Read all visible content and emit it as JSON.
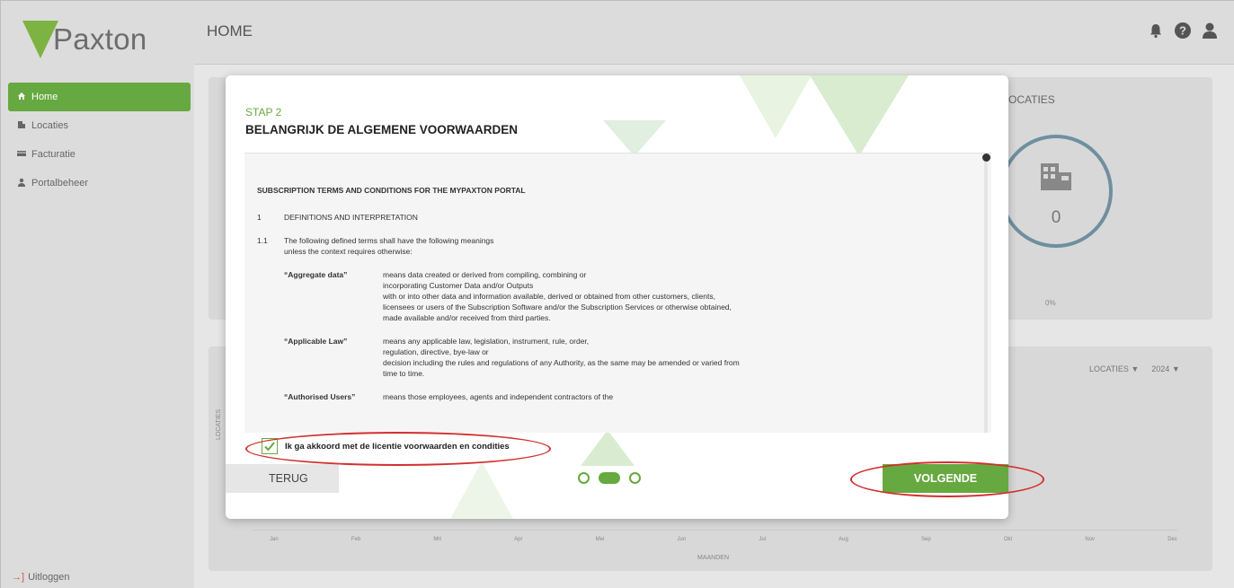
{
  "app": {
    "logo_text": "Paxton",
    "brand_color": "#66a940"
  },
  "sidebar": {
    "items": [
      {
        "label": "Home",
        "icon": "home-icon",
        "active": true
      },
      {
        "label": "Locaties",
        "icon": "building-icon",
        "active": false
      },
      {
        "label": "Facturatie",
        "icon": "billing-icon",
        "active": false
      },
      {
        "label": "Portalbeheer",
        "icon": "user-icon",
        "active": false
      }
    ],
    "logout_label": "Uitloggen"
  },
  "topbar": {
    "title": "HOME",
    "icons": [
      "bell-icon",
      "help-icon",
      "user-icon"
    ]
  },
  "dashboard": {
    "locations_title": "OCATIES",
    "locations_count": "0",
    "percent": "0%",
    "filter_locations": "LOCATIES",
    "filter_year": "2024",
    "chart_xlabel": "MAANDEN",
    "chart_ylabel": "LOCATIES",
    "months": [
      "Jan",
      "Feb",
      "Mrt",
      "Apr",
      "Mei",
      "Jun",
      "Jul",
      "Aug",
      "Sep",
      "Okt",
      "Nov",
      "Dec"
    ]
  },
  "modal": {
    "step": "STAP 2",
    "title": "BELANGRIJK DE ALGEMENE VOORWAARDEN",
    "terms": {
      "heading": "SUBSCRIPTION TERMS AND CONDITIONS FOR THE MYPAXTON PORTAL",
      "section_num": "1",
      "section_title": "DEFINITIONS AND INTERPRETATION",
      "para_num": "1.1",
      "para_text_1": "The following defined terms shall have the following meanings",
      "para_text_2": "unless the context requires otherwise:",
      "definitions": [
        {
          "term": "“Aggregate data”",
          "lines": [
            "means data created or derived from compiling, combining or",
            "incorporating Customer Data and/or Outputs",
            "with or into other data and information available, derived or obtained from other customers, clients,",
            "licensees or users of the Subscription Software and/or the Subscription Services or otherwise obtained,",
            "made available and/or received from third parties."
          ]
        },
        {
          "term": "“Applicable Law”",
          "lines": [
            "means any applicable law, legislation, instrument, rule, order,",
            "regulation, directive, bye-law or",
            "decision including the rules and regulations of any Authority, as the same may be amended or varied from",
            "time to time."
          ]
        },
        {
          "term": "“Authorised Users”",
          "lines": [
            "means those employees, agents and independent contractors of the"
          ]
        }
      ]
    },
    "agree_label": "Ik ga akkoord met de licentie voorwaarden en condities",
    "agree_checked": true,
    "back_label": "TERUG",
    "next_label": "VOLGENDE",
    "steps_total": 3,
    "current_step": 2
  }
}
